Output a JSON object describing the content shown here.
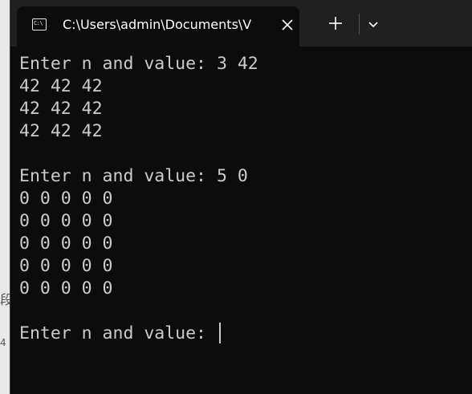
{
  "window": {
    "tab_title": "C:\\Users\\admin\\Documents\\V"
  },
  "icons": {
    "tab_icon": "C:\\",
    "close": "close-icon",
    "new_tab": "plus-icon",
    "dropdown": "chevron-down-icon"
  },
  "console": {
    "lines": [
      "Enter n and value: 3 42",
      "42 42 42",
      "42 42 42",
      "42 42 42",
      "",
      "Enter n and value: 5 0",
      "0 0 0 0 0",
      "0 0 0 0 0",
      "0 0 0 0 0",
      "0 0 0 0 0",
      "0 0 0 0 0",
      "",
      "Enter n and value: "
    ]
  },
  "colors": {
    "titlebar": "#202020",
    "terminal_background": "#0c0c0c",
    "terminal_text": "#cccccc"
  }
}
